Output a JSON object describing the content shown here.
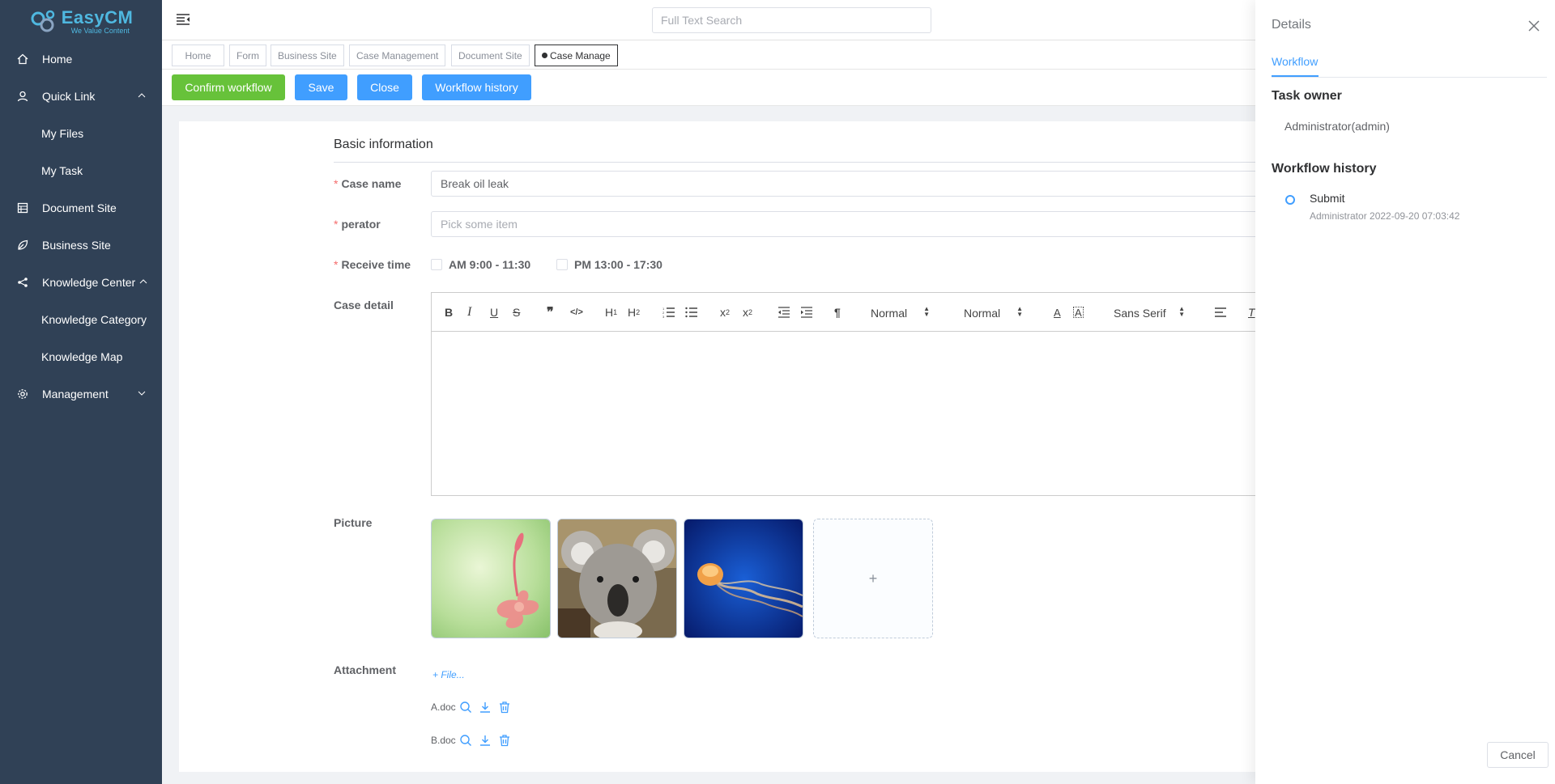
{
  "brand": {
    "name": "EasyCM",
    "slogan": "We Value Content",
    "color": "#4fb8e0"
  },
  "sidebar": {
    "items": [
      {
        "label": "Home",
        "icon": "home-icon"
      },
      {
        "label": "Quick Link",
        "icon": "user-icon",
        "expanded": true,
        "children": [
          {
            "label": "My Files"
          },
          {
            "label": "My Task"
          }
        ]
      },
      {
        "label": "Document Site",
        "icon": "document-icon"
      },
      {
        "label": "Business Site",
        "icon": "leaf-icon"
      },
      {
        "label": "Knowledge Center",
        "icon": "share-icon",
        "expanded": true,
        "children": [
          {
            "label": "Knowledge Category"
          },
          {
            "label": "Knowledge Map"
          }
        ]
      },
      {
        "label": "Management",
        "icon": "gear-icon",
        "expanded": false
      }
    ]
  },
  "header": {
    "search_placeholder": "Full Text Search"
  },
  "tags": [
    {
      "label": "Home"
    },
    {
      "label": "Form"
    },
    {
      "label": "Business Site"
    },
    {
      "label": "Case Management"
    },
    {
      "label": "Document Site"
    },
    {
      "label": "Case Manage",
      "active": true
    }
  ],
  "toolbar": {
    "confirm": "Confirm workflow",
    "save": "Save",
    "close": "Close",
    "history": "Workflow history"
  },
  "form": {
    "section_title": "Basic information",
    "case_name_label": "Case name",
    "case_name_value": "Break oil leak",
    "operator_label": "perator",
    "operator_placeholder": "Pick some item",
    "receive_time_label": "Receive time",
    "am_option": "AM 9:00 - 11:30",
    "pm_option": "PM 13:00 - 17:30",
    "case_detail_label": "Case detail",
    "editor": {
      "header_select": "Normal",
      "size_select": "Normal",
      "font_select": "Sans Serif",
      "h1": "H",
      "h1_sub": "1",
      "h2": "H",
      "h2_sub": "2",
      "sub": "x",
      "sub_s": "2",
      "sup": "x",
      "sup_s": "2"
    },
    "picture_label": "Picture",
    "pictures": [
      "flower",
      "koala",
      "jellyfish"
    ],
    "add_symbol": "+",
    "attachment_label": "Attachment",
    "add_file": "+ File...",
    "files": [
      {
        "name": "A.doc"
      },
      {
        "name": "B.doc"
      }
    ]
  },
  "drawer": {
    "title": "Details",
    "tab": "Workflow",
    "task_owner_heading": "Task owner",
    "task_owner": "Administrator(admin)",
    "history_heading": "Workflow history",
    "history": [
      {
        "title": "Submit",
        "meta": "Administrator 2022-09-20 07:03:42"
      }
    ],
    "cancel": "Cancel"
  },
  "colors": {
    "sidebar_bg": "#304156",
    "primary": "#409eff",
    "success": "#67c23a",
    "danger": "#f56c6c"
  }
}
